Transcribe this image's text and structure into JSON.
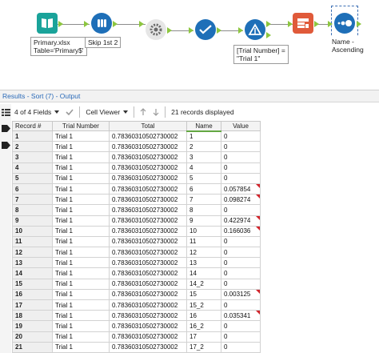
{
  "workflow": {
    "nodes": [
      {
        "id": "input",
        "icon": "book-input-icon",
        "color": "#1aa39a",
        "label": "Primary.xlsx\nTable='Primary$'"
      },
      {
        "id": "sample",
        "icon": "test-tubes-icon",
        "color": "#1e6fb8",
        "label": "Skip 1st 2"
      },
      {
        "id": "dynamic-rename",
        "icon": "gear-rename-icon",
        "color": "#808080",
        "label": ""
      },
      {
        "id": "select",
        "icon": "checkmark-select-icon",
        "color": "#1e6fb8",
        "label": ""
      },
      {
        "id": "filter",
        "icon": "triangle-filter-icon",
        "color": "#1e6fb8",
        "label": "[Trial Number] =\n\"Trial 1\""
      },
      {
        "id": "join",
        "icon": "table-join-icon",
        "color": "#e05a3a",
        "label": ""
      },
      {
        "id": "sort",
        "icon": "sort-icon",
        "color": "#1e6fb8",
        "label": "Name -\nAscending"
      }
    ],
    "filter_anchor_true": "T",
    "filter_anchor_false": "F"
  },
  "results": {
    "title": "Results - Sort (7) - Output",
    "fields_label": "4 of 4 Fields",
    "viewer_label": "Cell Viewer",
    "records_label": "21 records displayed"
  },
  "table": {
    "columns": [
      "Record #",
      "Trial Number",
      "Total",
      "Name",
      "Value"
    ],
    "rows": [
      [
        "1",
        "Trial 1",
        "0.78360310502730002",
        "1",
        "0"
      ],
      [
        "2",
        "Trial 1",
        "0.78360310502730002",
        "2",
        "0"
      ],
      [
        "3",
        "Trial 1",
        "0.78360310502730002",
        "3",
        "0"
      ],
      [
        "4",
        "Trial 1",
        "0.78360310502730002",
        "4",
        "0"
      ],
      [
        "5",
        "Trial 1",
        "0.78360310502730002",
        "5",
        "0"
      ],
      [
        "6",
        "Trial 1",
        "0.78360310502730002",
        "6",
        "0.057854"
      ],
      [
        "7",
        "Trial 1",
        "0.78360310502730002",
        "7",
        "0.098274"
      ],
      [
        "8",
        "Trial 1",
        "0.78360310502730002",
        "8",
        "0"
      ],
      [
        "9",
        "Trial 1",
        "0.78360310502730002",
        "9",
        "0.422974"
      ],
      [
        "10",
        "Trial 1",
        "0.78360310502730002",
        "10",
        "0.166036"
      ],
      [
        "11",
        "Trial 1",
        "0.78360310502730002",
        "11",
        "0"
      ],
      [
        "12",
        "Trial 1",
        "0.78360310502730002",
        "12",
        "0"
      ],
      [
        "13",
        "Trial 1",
        "0.78360310502730002",
        "13",
        "0"
      ],
      [
        "14",
        "Trial 1",
        "0.78360310502730002",
        "14",
        "0"
      ],
      [
        "15",
        "Trial 1",
        "0.78360310502730002",
        "14_2",
        "0"
      ],
      [
        "16",
        "Trial 1",
        "0.78360310502730002",
        "15",
        "0.003125"
      ],
      [
        "17",
        "Trial 1",
        "0.78360310502730002",
        "15_2",
        "0"
      ],
      [
        "18",
        "Trial 1",
        "0.78360310502730002",
        "16",
        "0.035341"
      ],
      [
        "19",
        "Trial 1",
        "0.78360310502730002",
        "16_2",
        "0"
      ],
      [
        "20",
        "Trial 1",
        "0.78360310502730002",
        "17",
        "0"
      ],
      [
        "21",
        "Trial 1",
        "0.78360310502730002",
        "17_2",
        "0"
      ]
    ],
    "flagged_rows": [
      6,
      7,
      9,
      10,
      16,
      18
    ]
  },
  "colors": {
    "accent_green": "#8dc63f",
    "link_blue": "#2a6ab8",
    "flag_red": "#d2232a"
  }
}
